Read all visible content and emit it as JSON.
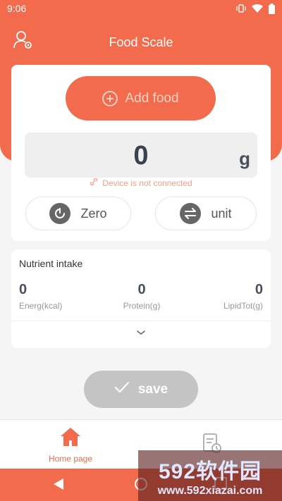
{
  "status_bar": {
    "time": "9:06"
  },
  "header": {
    "title": "Food Scale"
  },
  "scale": {
    "add_food_label": "Add food",
    "weight_value": "0",
    "weight_unit": "g",
    "connection_status": "Device is not connected",
    "zero_label": "Zero",
    "unit_label": "unit"
  },
  "nutrients": {
    "title": "Nutrient intake",
    "items": [
      {
        "value": "0",
        "label": "Energ(kcal)"
      },
      {
        "value": "0",
        "label": "Protein(g)"
      },
      {
        "value": "0",
        "label": "LipidTot(g)"
      }
    ]
  },
  "save_label": "save",
  "tabs": [
    {
      "label": "Home page",
      "active": true
    }
  ],
  "watermark": {
    "big": "592软件园",
    "small": "www.592xiazai.com"
  },
  "colors": {
    "accent": "#f26b4c",
    "disabled": "#c4c4c4"
  }
}
